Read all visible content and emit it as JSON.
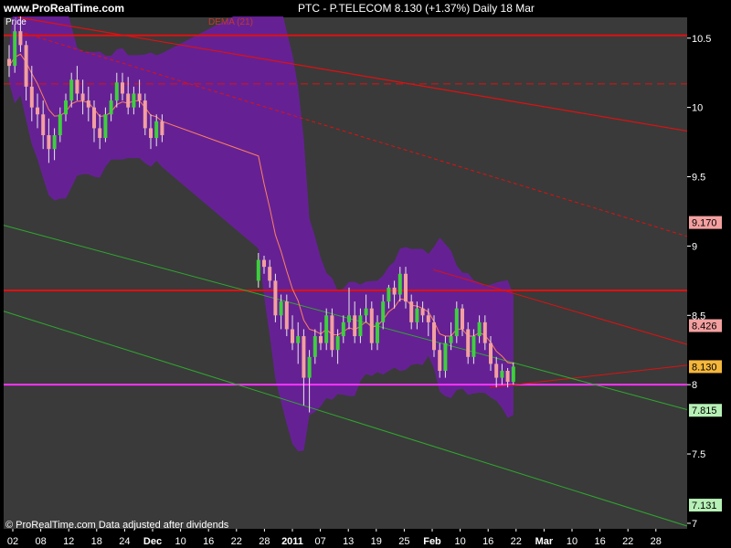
{
  "header": {
    "site": "www.ProRealTime.com",
    "ticker_line": "PTC - P.TELECOM    8.130 (+1.37%)    Daily  18 Mar"
  },
  "legend": {
    "price": "Price",
    "dema": "DEMA (21)"
  },
  "footer": {
    "text": "© ProRealTime.com  Data adjusted after dividends"
  },
  "colors": {
    "background": "#3a3a3a",
    "band": "#6a1f9e",
    "up": "#3ecf3e",
    "down": "#f2a0a0",
    "red_line": "#e01010",
    "green_line": "#2fa82f",
    "magenta": "#ff33ff",
    "dema": "#ff8060"
  },
  "chart_data": {
    "type": "candlestick",
    "title": "PTC - P.TELECOM",
    "x_tick_labels": [
      "02",
      "08",
      "12",
      "18",
      "24",
      "Dec",
      "10",
      "16",
      "22",
      "28",
      "2011",
      "07",
      "13",
      "19",
      "25",
      "Feb",
      "10",
      "16",
      "22",
      "Mar",
      "10",
      "16",
      "22",
      "28"
    ],
    "y_ticks": [
      7,
      7.5,
      8,
      8.5,
      9,
      9.5,
      10,
      10.5
    ],
    "ylim": [
      6.96,
      10.65
    ],
    "price_labels": [
      {
        "value": "9.170",
        "color": "#f4a0a0"
      },
      {
        "value": "8.426",
        "color": "#f4a0a0"
      },
      {
        "value": "8.130",
        "color": "#f5b73b"
      },
      {
        "value": "7.815",
        "color": "#b6f0b6"
      },
      {
        "value": "7.131",
        "color": "#b6f0b6"
      }
    ],
    "horizontal_levels": [
      10.52,
      8.68,
      8.0
    ],
    "dashed_level": 10.17,
    "candles": [
      [
        10.35,
        10.45,
        10.22,
        10.3
      ],
      [
        10.3,
        10.6,
        10.25,
        10.55
      ],
      [
        10.55,
        10.7,
        10.4,
        10.45
      ],
      [
        10.45,
        10.48,
        10.05,
        10.15
      ],
      [
        10.15,
        10.3,
        9.9,
        10.0
      ],
      [
        10.0,
        10.1,
        9.85,
        9.95
      ],
      [
        9.95,
        10.05,
        9.7,
        9.8
      ],
      [
        9.8,
        9.92,
        9.6,
        9.7
      ],
      [
        9.7,
        9.85,
        9.62,
        9.8
      ],
      [
        9.8,
        10.0,
        9.75,
        9.95
      ],
      [
        9.95,
        10.1,
        9.9,
        10.05
      ],
      [
        10.05,
        10.25,
        10.0,
        10.2
      ],
      [
        10.2,
        10.3,
        10.05,
        10.1
      ],
      [
        10.1,
        10.2,
        9.95,
        10.05
      ],
      [
        10.05,
        10.15,
        9.9,
        10.0
      ],
      [
        10.0,
        10.05,
        9.75,
        9.85
      ],
      [
        9.85,
        9.95,
        9.7,
        9.78
      ],
      [
        9.78,
        10.0,
        9.75,
        9.95
      ],
      [
        9.95,
        10.1,
        9.9,
        10.05
      ],
      [
        10.05,
        10.25,
        10.0,
        10.18
      ],
      [
        10.18,
        10.25,
        10.05,
        10.1
      ],
      [
        10.1,
        10.22,
        9.95,
        10.0
      ],
      [
        10.0,
        10.15,
        9.95,
        10.1
      ],
      [
        10.1,
        10.2,
        10.0,
        10.05
      ],
      [
        10.05,
        10.1,
        9.8,
        9.85
      ],
      [
        9.85,
        9.95,
        9.7,
        9.78
      ],
      [
        9.78,
        9.95,
        9.72,
        9.9
      ],
      [
        9.9,
        9.95,
        9.75,
        9.8
      ],
      [
        8.75,
        8.95,
        8.7,
        8.9
      ],
      [
        8.9,
        8.93,
        8.8,
        8.85
      ],
      [
        8.85,
        8.9,
        8.7,
        8.75
      ],
      [
        8.75,
        8.8,
        8.45,
        8.5
      ],
      [
        8.5,
        8.65,
        8.4,
        8.6
      ],
      [
        8.6,
        8.65,
        8.35,
        8.4
      ],
      [
        8.4,
        8.5,
        8.25,
        8.3
      ],
      [
        8.3,
        8.45,
        8.15,
        8.35
      ],
      [
        8.35,
        8.4,
        7.85,
        8.05
      ],
      [
        8.05,
        8.25,
        7.8,
        8.2
      ],
      [
        8.2,
        8.4,
        8.15,
        8.35
      ],
      [
        8.35,
        8.45,
        8.25,
        8.3
      ],
      [
        8.3,
        8.55,
        8.25,
        8.5
      ],
      [
        8.5,
        8.55,
        8.2,
        8.25
      ],
      [
        8.25,
        8.4,
        8.15,
        8.35
      ],
      [
        8.35,
        8.5,
        8.3,
        8.45
      ],
      [
        8.45,
        8.7,
        8.4,
        8.5
      ],
      [
        8.5,
        8.6,
        8.3,
        8.35
      ],
      [
        8.35,
        8.55,
        8.3,
        8.5
      ],
      [
        8.5,
        8.65,
        8.45,
        8.55
      ],
      [
        8.55,
        8.6,
        8.25,
        8.3
      ],
      [
        8.3,
        8.5,
        8.25,
        8.45
      ],
      [
        8.45,
        8.65,
        8.4,
        8.6
      ],
      [
        8.6,
        8.72,
        8.55,
        8.7
      ],
      [
        8.7,
        8.75,
        8.55,
        8.65
      ],
      [
        8.65,
        8.85,
        8.6,
        8.8
      ],
      [
        8.8,
        8.85,
        8.55,
        8.6
      ],
      [
        8.6,
        8.65,
        8.4,
        8.45
      ],
      [
        8.45,
        8.6,
        8.4,
        8.55
      ],
      [
        8.55,
        8.6,
        8.45,
        8.5
      ],
      [
        8.5,
        8.55,
        8.35,
        8.45
      ],
      [
        8.45,
        8.5,
        8.2,
        8.25
      ],
      [
        8.25,
        8.3,
        8.05,
        8.1
      ],
      [
        8.1,
        8.35,
        8.05,
        8.3
      ],
      [
        8.3,
        8.45,
        8.25,
        8.35
      ],
      [
        8.35,
        8.6,
        8.3,
        8.55
      ],
      [
        8.55,
        8.58,
        8.35,
        8.4
      ],
      [
        8.4,
        8.45,
        8.15,
        8.2
      ],
      [
        8.2,
        8.4,
        8.15,
        8.35
      ],
      [
        8.35,
        8.5,
        8.3,
        8.45
      ],
      [
        8.45,
        8.5,
        8.25,
        8.3
      ],
      [
        8.3,
        8.35,
        8.1,
        8.15
      ],
      [
        8.15,
        8.2,
        7.98,
        8.05
      ],
      [
        8.05,
        8.15,
        8.0,
        8.1
      ],
      [
        8.1,
        8.12,
        7.98,
        8.02
      ],
      [
        8.02,
        8.16,
        8.0,
        8.13
      ]
    ]
  }
}
